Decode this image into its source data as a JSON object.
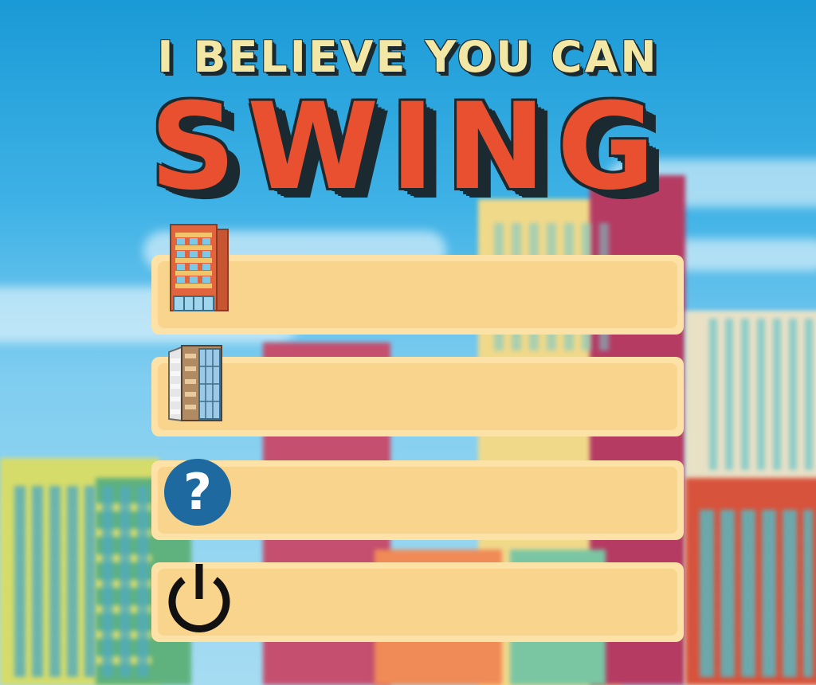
{
  "title": {
    "line1": "I BELIEVE YOU CAN",
    "line2": "SWING"
  },
  "menu": {
    "items": [
      {
        "id": "play",
        "label": "",
        "icon": "building-orange-icon"
      },
      {
        "id": "levels",
        "label": "",
        "icon": "building-glass-icon"
      },
      {
        "id": "help",
        "label": "",
        "icon": "help-icon",
        "glyph": "?"
      },
      {
        "id": "quit",
        "label": "",
        "icon": "power-icon"
      }
    ]
  },
  "colors": {
    "title_top": "#f3e7a6",
    "title_main": "#e8502f",
    "outline": "#1b2a30",
    "button_outer": "#fce2a6",
    "button_inner": "#f8d48c",
    "help_icon_bg": "#1e6aa0"
  }
}
